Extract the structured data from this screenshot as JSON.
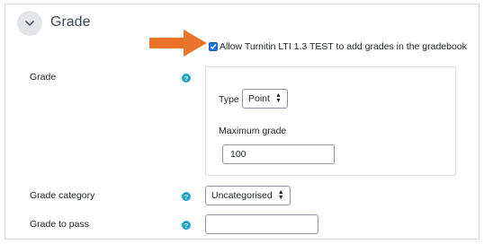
{
  "section": {
    "title": "Grade",
    "toggle_icon": "chevron-down-icon"
  },
  "checkbox": {
    "label": "Allow Turnitin LTI 1.3 TEST to add grades in the gradebook",
    "checked": true
  },
  "grade": {
    "label": "Grade",
    "type_label": "Type",
    "type_value": "Point",
    "max_grade_label": "Maximum grade",
    "max_grade_value": "100"
  },
  "grade_category": {
    "label": "Grade category",
    "value": "Uncategorised"
  },
  "grade_to_pass": {
    "label": "Grade to pass",
    "value": ""
  },
  "colors": {
    "arrow": "#e8742a",
    "help": "#1ea7c8",
    "checkbox": "#1a73e8"
  }
}
